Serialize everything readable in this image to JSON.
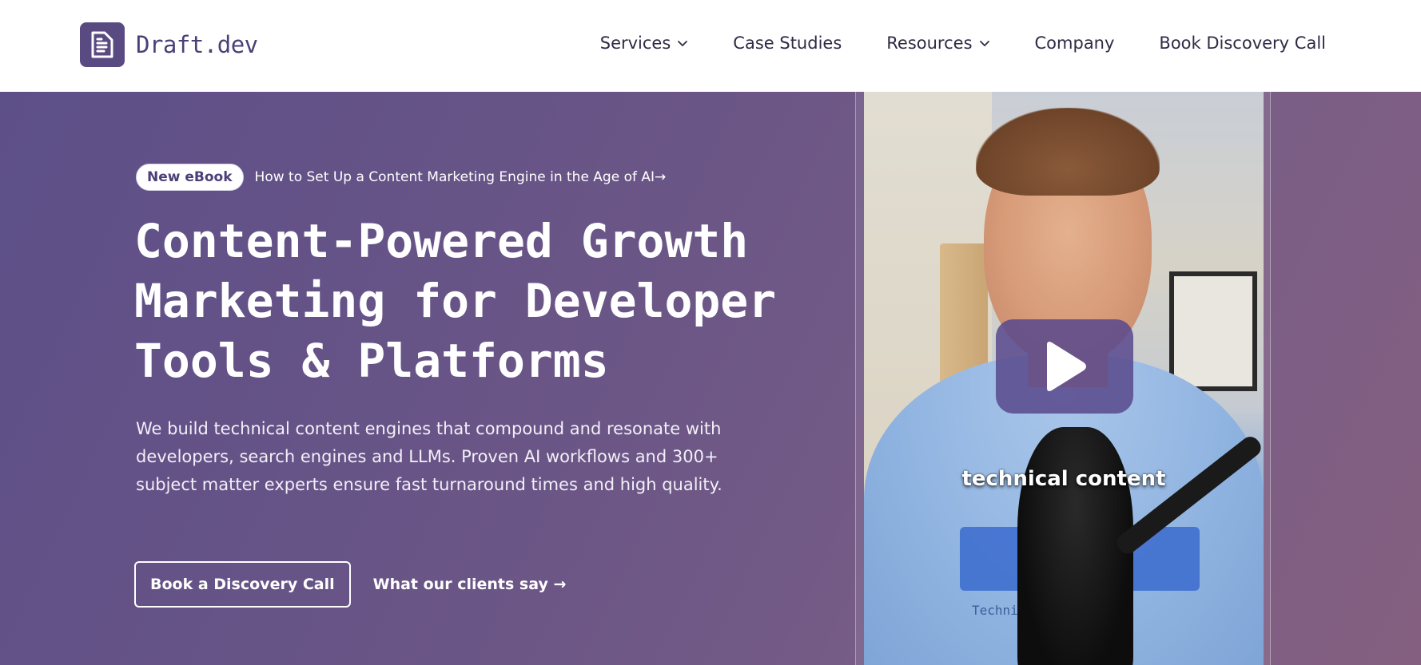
{
  "brand": {
    "name": "Draft.dev",
    "logo_icon": "document-icon",
    "color": "#5a4a82"
  },
  "nav": {
    "items": [
      {
        "label": "Services",
        "has_dropdown": true
      },
      {
        "label": "Case Studies",
        "has_dropdown": false
      },
      {
        "label": "Resources",
        "has_dropdown": true
      },
      {
        "label": "Company",
        "has_dropdown": false
      },
      {
        "label": "Book Discovery Call",
        "has_dropdown": false
      }
    ]
  },
  "hero": {
    "badge": "New eBook",
    "badge_link": "How to Set Up a Content Marketing Engine in the Age of AI→",
    "headline_lines": [
      "Content-Powered Growth",
      "Marketing for Developer",
      "Tools & Platforms"
    ],
    "subtext": "We build technical content engines that compound and resonate with developers, search engines and LLMs. Proven AI workflows and 300+ subject matter experts ensure fast turnaround times and high quality.",
    "cta_primary": "Book a Discovery Call",
    "cta_secondary": "What our clients say →"
  },
  "video": {
    "caption": "technical content",
    "shirt_text": "Technica          ting",
    "play_icon": "play-icon"
  },
  "colors": {
    "hero_start": "#5d4f88",
    "hero_end": "#845f80",
    "text_dark": "#2f2b45"
  }
}
